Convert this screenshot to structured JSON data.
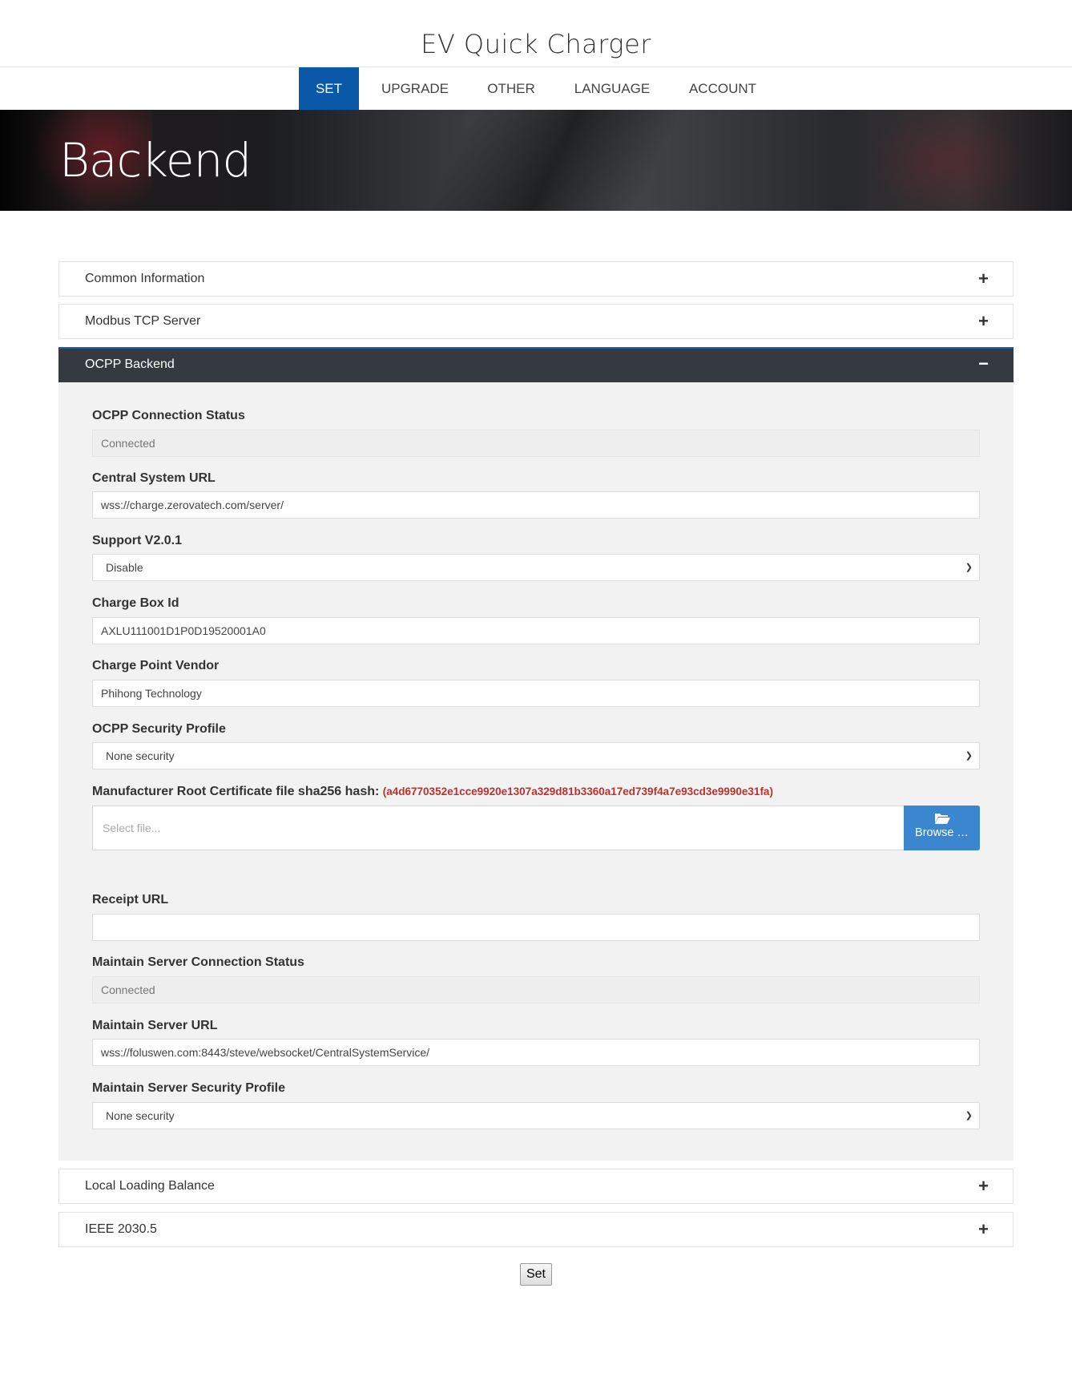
{
  "site": {
    "title": "EV Quick Charger"
  },
  "nav": {
    "items": [
      {
        "label": "SET",
        "active": true
      },
      {
        "label": "UPGRADE"
      },
      {
        "label": "OTHER"
      },
      {
        "label": "LANGUAGE"
      },
      {
        "label": "ACCOUNT"
      }
    ]
  },
  "hero": {
    "title": "Backend"
  },
  "panels": {
    "common": {
      "label": "Common Information",
      "toggle": "+"
    },
    "modbus": {
      "label": "Modbus TCP Server",
      "toggle": "+"
    },
    "ocpp": {
      "label": "OCPP Backend",
      "toggle": "−"
    },
    "balance": {
      "label": "Local Loading Balance",
      "toggle": "+"
    },
    "ieee": {
      "label": "IEEE 2030.5",
      "toggle": "+"
    }
  },
  "form": {
    "conn_status": {
      "label": "OCPP Connection Status",
      "value": "Connected"
    },
    "central_url": {
      "label": "Central System URL",
      "value": "wss://charge.zerovatech.com/server/"
    },
    "support_v201": {
      "label": "Support V2.0.1",
      "value": "Disable"
    },
    "charge_box_id": {
      "label": "Charge Box Id",
      "value": "AXLU111001D1P0D19520001A0"
    },
    "vendor": {
      "label": "Charge Point Vendor",
      "value": "Phihong Technology"
    },
    "security_profile": {
      "label": "OCPP Security Profile",
      "value": "None security"
    },
    "root_cert": {
      "label": "Manufacturer Root Certificate file sha256 hash:",
      "hash": "(a4d6770352e1cce9920e1307a329d81b3360a17ed739f4a7e93cd3e9990e31fa)",
      "placeholder": "Select file...",
      "browse_label": "Browse …"
    },
    "receipt_url": {
      "label": "Receipt URL",
      "value": ""
    },
    "maint_status": {
      "label": "Maintain Server Connection Status",
      "value": "Connected"
    },
    "maint_url": {
      "label": "Maintain Server URL",
      "value": "wss://foluswen.com:8443/steve/websocket/CentralSystemService/"
    },
    "maint_profile": {
      "label": "Maintain Server Security Profile",
      "value": "None security"
    }
  },
  "actions": {
    "set_label": "Set"
  },
  "icons": {
    "expand": "plus-icon",
    "collapse": "minus-icon",
    "select": "chevron-down-icon",
    "browse": "folder-open-icon"
  },
  "colors": {
    "nav_active": "#0959a8",
    "panel_open": "#343a40",
    "browse": "#3a87cf",
    "hash": "#c0302a"
  }
}
